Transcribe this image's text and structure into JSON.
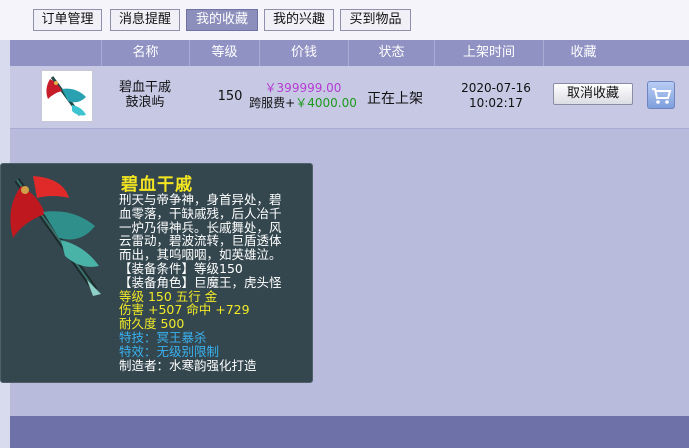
{
  "tabs": [
    {
      "label": "订单管理",
      "active": false
    },
    {
      "label": "消息提醒",
      "active": false
    },
    {
      "label": "我的收藏",
      "active": true
    },
    {
      "label": "我的兴趣",
      "active": false
    },
    {
      "label": "买到物品",
      "active": false
    }
  ],
  "table": {
    "headers": [
      "名称",
      "等级",
      "价钱",
      "状态",
      "上架时间",
      "收藏"
    ],
    "rows": [
      {
        "name_line1": "碧血干戚",
        "name_line2": "鼓浪屿",
        "level": "150",
        "price": "￥399999.00",
        "fee_label": "跨服费+",
        "fee_value": "￥4000.00",
        "status": "正在上架",
        "date": "2020-07-16",
        "time": "10:02:17",
        "action": "取消收藏",
        "cart_icon": "shopping-cart-icon"
      }
    ]
  },
  "tooltip": {
    "title": "碧血干戚",
    "desc": [
      "刑天与帝争神，身首异处，碧",
      "血零落，干缺戚残，后人冶千",
      "一炉乃得神兵。长戚舞处，风",
      "云雷动，碧波流转，巨盾透体",
      "而出，其呜咽咽，如英雄泣。"
    ],
    "req": [
      "【装备条件】等级150",
      "【装备角色】巨魔王，虎头怪"
    ],
    "stats": [
      "等级 150  五行 金",
      "伤害 +507 命中 +729",
      "耐久度 500"
    ],
    "skills": [
      "特技：冥王暴杀",
      "特效：无级别限制"
    ],
    "maker": "制造者：水寒韵强化打造"
  },
  "colors": {
    "accent": "#8f92c3",
    "price": "#b63bd3",
    "fee": "#1e9a1e",
    "title": "#f3e520",
    "skill": "#3ab0ee"
  }
}
